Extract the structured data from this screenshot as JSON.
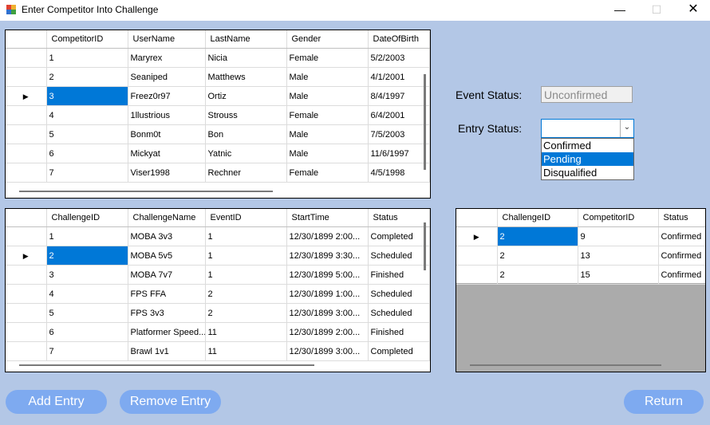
{
  "window": {
    "title": "Enter Competitor Into Challenge",
    "minimize": "—",
    "maximize": "☐",
    "close": "✕"
  },
  "competitors_grid": {
    "columns": [
      "CompetitorID",
      "UserName",
      "LastName",
      "Gender",
      "DateOfBirth"
    ],
    "rows": [
      [
        "1",
        "Maryrex",
        "Nicia",
        "Female",
        "5/2/2003"
      ],
      [
        "2",
        "Seaniped",
        "Matthews",
        "Male",
        "4/1/2001"
      ],
      [
        "3",
        "Freez0r97",
        "Ortiz",
        "Male",
        "8/4/1997"
      ],
      [
        "4",
        "1llustrious",
        "Strouss",
        "Female",
        "6/4/2001"
      ],
      [
        "5",
        "Bonm0t",
        "Bon",
        "Male",
        "7/5/2003"
      ],
      [
        "6",
        "Mickyat",
        "Yatnic",
        "Male",
        "11/6/1997"
      ],
      [
        "7",
        "Viser1998",
        "Rechner",
        "Female",
        "4/5/1998"
      ]
    ],
    "selected_row": 2
  },
  "challenges_grid": {
    "columns": [
      "ChallengeID",
      "ChallengeName",
      "EventID",
      "StartTime",
      "Status"
    ],
    "rows": [
      [
        "1",
        "MOBA 3v3",
        "1",
        "12/30/1899 2:00...",
        "Completed"
      ],
      [
        "2",
        "MOBA 5v5",
        "1",
        "12/30/1899 3:30...",
        "Scheduled"
      ],
      [
        "3",
        "MOBA 7v7",
        "1",
        "12/30/1899 5:00...",
        "Finished"
      ],
      [
        "4",
        "FPS FFA",
        "2",
        "12/30/1899 1:00...",
        "Scheduled"
      ],
      [
        "5",
        "FPS 3v3",
        "2",
        "12/30/1899 3:00...",
        "Scheduled"
      ],
      [
        "6",
        "Platformer Speed...",
        "11",
        "12/30/1899 2:00...",
        "Finished"
      ],
      [
        "7",
        "Brawl 1v1",
        "11",
        "12/30/1899 3:00...",
        "Completed"
      ]
    ],
    "selected_row": 1
  },
  "entries_grid": {
    "columns": [
      "ChallengeID",
      "CompetitorID",
      "Status"
    ],
    "rows": [
      [
        "2",
        "9",
        "Confirmed"
      ],
      [
        "2",
        "13",
        "Confirmed"
      ],
      [
        "2",
        "15",
        "Confirmed"
      ]
    ],
    "selected_row": 0
  },
  "event_status": {
    "label": "Event Status:",
    "value": "Unconfirmed"
  },
  "entry_status": {
    "label": "Entry Status:",
    "value": "",
    "options": [
      "Confirmed",
      "Pending",
      "Disqualified"
    ],
    "highlighted": 1
  },
  "buttons": {
    "add_entry": "Add Entry",
    "remove_entry": "Remove Entry",
    "return": "Return"
  },
  "colors": {
    "background": "#b3c7e6",
    "selection": "#0078d7",
    "button": "#7eaaf0"
  }
}
